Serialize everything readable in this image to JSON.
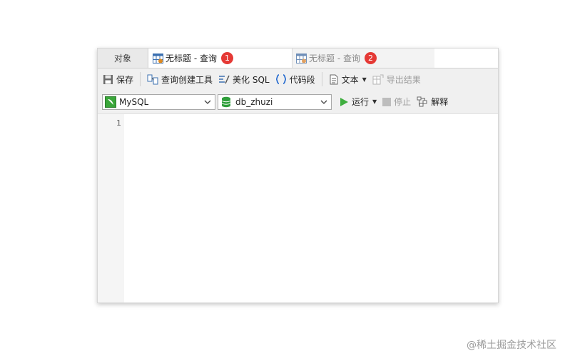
{
  "tabs": {
    "objects_label": "对象",
    "query1_label": "无标题 - 查询",
    "query1_badge": "1",
    "query2_label": "无标题 - 查询",
    "query2_badge": "2"
  },
  "toolbar": {
    "save_label": "保存",
    "query_builder_label": "查询创建工具",
    "beautify_label": "美化 SQL",
    "snippet_label": "代码段",
    "text_label": "文本",
    "export_label": "导出结果"
  },
  "connection": {
    "connection_value": "MySQL",
    "database_value": "db_zhuzi",
    "run_label": "运行",
    "stop_label": "停止",
    "explain_label": "解释"
  },
  "editor": {
    "line_number": "1"
  },
  "watermark": "@稀土掘金技术社区",
  "colors": {
    "badge": "#e53935",
    "run_green": "#3fae3f",
    "db_green": "#2e9e3a"
  }
}
